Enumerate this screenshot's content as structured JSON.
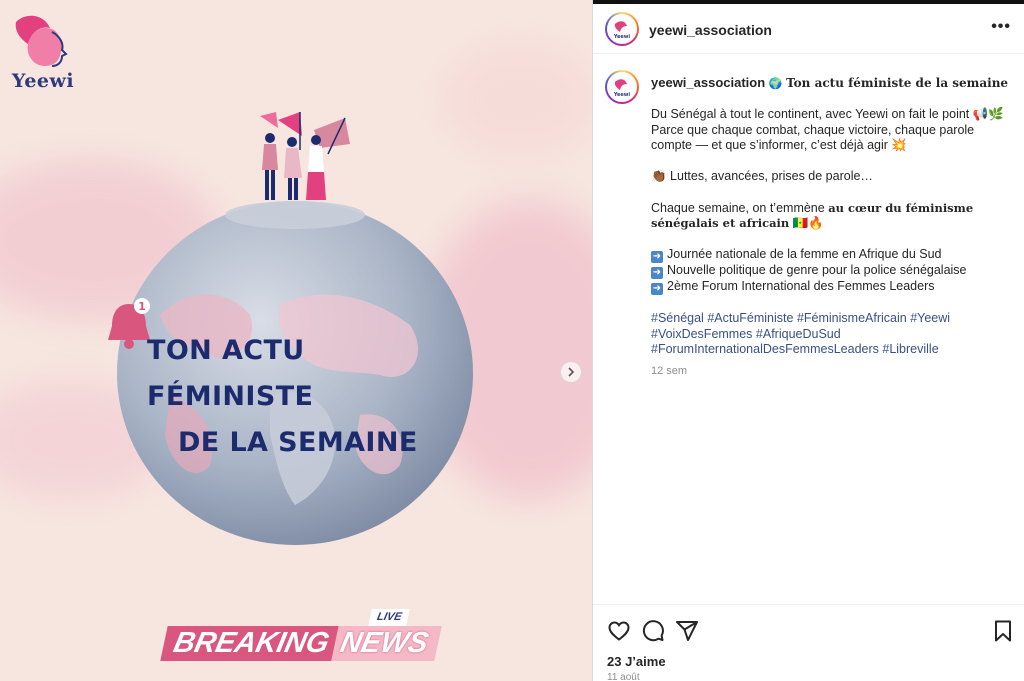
{
  "media": {
    "logo_text": "Yeewi",
    "headline_line1": "TON ACTU FÉMINISTE",
    "headline_line2": "DE LA SEMAINE",
    "bell_badge": "1",
    "live_label": "LIVE",
    "breaking_word1": "BREAKING",
    "breaking_word2": "NEWS",
    "next_icon": "chevron-right-icon",
    "colors": {
      "navy": "#1c2b6e",
      "pink": "#d9577e",
      "light_pink": "#f4b8c6",
      "background": "#f7e6e0"
    }
  },
  "header": {
    "username": "yeewi_association",
    "avatar_text": "Yeewi",
    "more_icon": "more-horizontal-icon",
    "more_label": "•••"
  },
  "caption": {
    "username": "yeewi_association",
    "globe_emoji": "🌍",
    "title": "Ton actu féministe de la semaine",
    "line1": "Du Sénégal à tout le continent, avec Yeewi on fait le point 📢🌿",
    "line2": "Parce que chaque combat, chaque victoire, chaque parole compte — et que s’informer, c’est déjà agir 💥",
    "line3": "👏🏾 Luttes, avancées, prises de parole…",
    "line4_pre": "Chaque semaine, on t’emmène ",
    "line4_bold": "au cœur du féminisme sénégalais et africain",
    "line4_post": " 🇸🇳🔥",
    "items": [
      "Journée nationale de la femme en Afrique du Sud",
      "Nouvelle politique de genre pour la police sénégalaise",
      "2ème Forum International des Femmes Leaders"
    ],
    "hashtags": [
      "#Sénégal",
      "#ActuFéministe",
      "#FéminismeAfricain",
      "#Yeewi",
      "#VoixDesFemmes",
      "#AfriqueDuSud",
      "#ForumInternationalDesFemmesLeaders",
      "#Libreville"
    ],
    "time_ago": "12 sem"
  },
  "actions": {
    "like_icon": "heart-icon",
    "comment_icon": "comment-icon",
    "share_icon": "send-icon",
    "save_icon": "bookmark-icon",
    "likes": "23 J’aime",
    "date": "11 août"
  }
}
